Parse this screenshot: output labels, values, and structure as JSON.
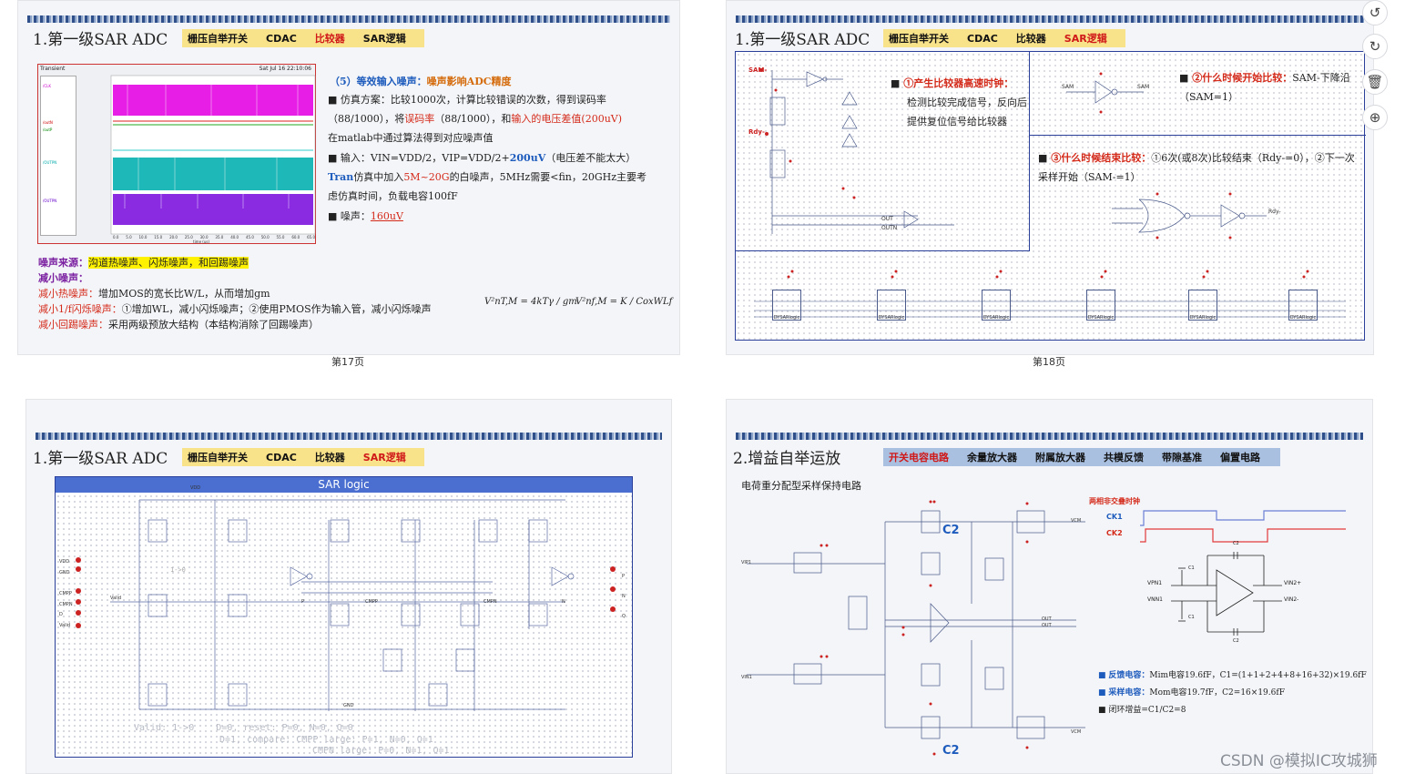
{
  "side_tools": [
    {
      "icon": "refresh-icon",
      "glyph": "↺"
    },
    {
      "icon": "undo-icon",
      "glyph": "↻"
    },
    {
      "icon": "trash-icon",
      "glyph": "🗑"
    },
    {
      "icon": "plus-icon",
      "glyph": "⊕"
    }
  ],
  "watermark": "CSDN @模拟IC攻城狮",
  "slide1": {
    "title": "1.第一级SAR ADC",
    "tags": [
      "栅压自举开关",
      "CDAC",
      "比较器",
      "SAR逻辑"
    ],
    "active_tag": 2,
    "page_label": "第17页",
    "plot_title": "Transient",
    "plot_date": "Sat Jul 16 22:10:06",
    "plot_xlabel": "time (us)",
    "plot_xticks": [
      "0.0",
      "5.0",
      "10.0",
      "15.0",
      "20.0",
      "25.0",
      "30.0",
      "35.0",
      "40.0",
      "45.0",
      "50.0",
      "55.0",
      "60.0",
      "65.0"
    ],
    "plot_legend": [
      "/CLK",
      "/outN",
      "/outP",
      "/OUTPN",
      "/OUTPN"
    ],
    "heading": "（5）等效输入噪声：噪声影响ADC精度",
    "heading_prefix": "（5）等效输入噪声：",
    "heading_suffix": "噪声影响ADC精度",
    "bullet1_a": "仿真方案：比较1000次，计算比较错误的次数，得到误码率（88/1000），将",
    "bullet1_b": "误码率",
    "bullet1_c": "（88/1000），和",
    "bullet1_d": "输入的电压差值(200uV)",
    "bullet1_e": "在matlab中通过算法得到对应噪声值",
    "bullet2_a": "输入：VIN=VDD/2，VIP=VDD/2+",
    "bullet2_b": "200uV",
    "bullet2_c": "（电压差不能太大）",
    "bullet2_d": "Tran",
    "bullet2_e": "仿真中加入",
    "bullet2_f": "5M~20G",
    "bullet2_g": "的白噪声，5MHz需要<fin，20GHz主要考虑仿真时间，负载电容100fF",
    "bullet3_a": "噪声：",
    "bullet3_b": "160uV",
    "noise_src_label": "噪声来源：",
    "noise_src_value": "沟道热噪声、闪烁噪声，和回踢噪声",
    "reduce_label": "减小噪声：",
    "reduce1_a": "减小热噪声：",
    "reduce1_b": "增加MOS的宽长比W/L，从而增加gm",
    "reduce2_a": "减小1/f闪烁噪声：",
    "reduce2_b": "①增加WL，减小闪烁噪声；②使用PMOS作为输入管，减小闪烁噪声",
    "reduce3_a": "减小回踢噪声：",
    "reduce3_b": "采用两级预放大结构（本结构消除了回踢噪声）",
    "formula1": "V²nT,M = 4kTγ / gm",
    "formula2": "V²nf,M = K / CoxWLf"
  },
  "slide2": {
    "title": "1.第一级SAR ADC",
    "tags": [
      "栅压自举开关",
      "CDAC",
      "比较器",
      "SAR逻辑"
    ],
    "active_tag": 3,
    "page_label": "第18页",
    "item1_title": "①产生比较器高速时钟：",
    "item1_body": "检测比较完成信号，反向后提供复位信号给比较器",
    "item2_title": "②什么时候开始比较：",
    "item2_body": "SAM-下降沿（SAM=1）",
    "item3_title": "③什么时候结束比较：",
    "item3_body": "①6次(或8次)比较结束（Rdy-=0），②下一次采样开始（SAM-=1）",
    "sch_labels": [
      "SAM-",
      "Rdy-",
      "SAM",
      "SAM",
      "Rdy-",
      "OUT",
      "OUTN"
    ],
    "dysar_blocks": [
      "DYSARlogic",
      "DYSARlogic",
      "DYSARlogic",
      "DYSARlogic",
      "DYSARlogic",
      "DYSARlogic"
    ]
  },
  "slide3": {
    "title": "1.第一级SAR ADC",
    "tags": [
      "栅压自举开关",
      "CDAC",
      "比较器",
      "SAR逻辑"
    ],
    "active_tag": 3,
    "panel_title": "SAR logic",
    "pins_left": [
      "VDD",
      "GND",
      "CMPP",
      "CMPN",
      "D",
      "Valid"
    ],
    "pins_right": [
      "P",
      "N",
      "Q"
    ],
    "net_labels": [
      "VDD",
      "GND",
      "Valid",
      "P",
      "N",
      "CMPP",
      "CMPN",
      "1->0"
    ],
    "note1": "Valid: 1->0    D=0, reset: P=0, N=0, Q=0",
    "note2": "D=1, compare: CMPP large: P=1, N=0, Q=1",
    "note3": "CMPN large: P=0, N=1, Q=1"
  },
  "slide4": {
    "title": "2.增益自举运放",
    "tags": [
      "开关电容电路",
      "余量放大器",
      "附属放大器",
      "共模反馈",
      "带隙基准",
      "偏置电路"
    ],
    "active_tag": 0,
    "subtitle": "电荷重分配型采样保持电路",
    "clock_title": "两相非交叠时钟",
    "ck1": "CK1",
    "ck2": "CK2",
    "c2_top": "C2",
    "c2_bottom": "C2",
    "opamp_labels": [
      "VPN1",
      "VNN1",
      "VIN2+",
      "VIN2-",
      "C1",
      "C1",
      "C2",
      "C2"
    ],
    "bullet1_a": "反馈电容：",
    "bullet1_b": "Mim电容19.6fF，C1=(1+1+2+4+8+16+32)×19.6fF",
    "bullet2_a": "采样电容：",
    "bullet2_b": "Mom电容19.7fF，C2=16×19.6fF",
    "bullet3": "闭环增益=C1/C2=8",
    "net_labels": [
      "VIP1",
      "VIN1",
      "VCM",
      "VCM",
      "OUT",
      "OUT"
    ]
  },
  "colors": {
    "accent_red": "#d42a1a",
    "accent_blue": "#1d5bbd",
    "tag_yellow": "#f8e28a",
    "tag_blue": "#a9c0e0",
    "schematic_border": "#2a3f9a"
  }
}
